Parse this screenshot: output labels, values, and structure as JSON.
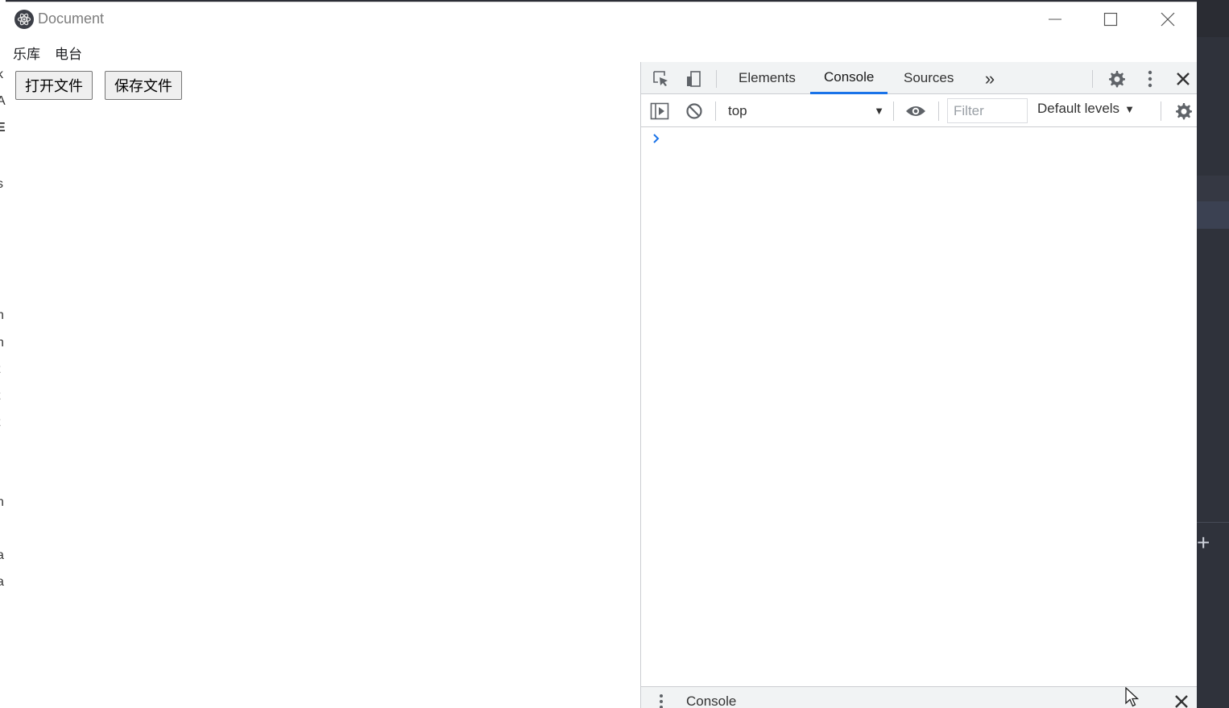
{
  "window": {
    "title": "Document"
  },
  "menu": [
    "乐库",
    "电台"
  ],
  "buttons": {
    "open_file": "打开文件",
    "save_file": "保存文件"
  },
  "devtools": {
    "tabs": [
      "Elements",
      "Console",
      "Sources"
    ],
    "active_tab": "Console",
    "context": "top",
    "filter_placeholder": "Filter",
    "levels": "Default levels",
    "drawer_title": "Console"
  },
  "colors": {
    "accent": "#1a73e8",
    "background_editor": "#2b2d35"
  },
  "icons": [
    "app-logo-icon",
    "minimize-icon",
    "maximize-icon",
    "close-icon",
    "inspect-element-icon",
    "device-toggle-icon",
    "more-tabs-icon",
    "settings-icon",
    "kebab-menu-icon",
    "sidebar-toggle-icon",
    "clear-console-icon",
    "eye-icon",
    "mouse-cursor-icon"
  ]
}
